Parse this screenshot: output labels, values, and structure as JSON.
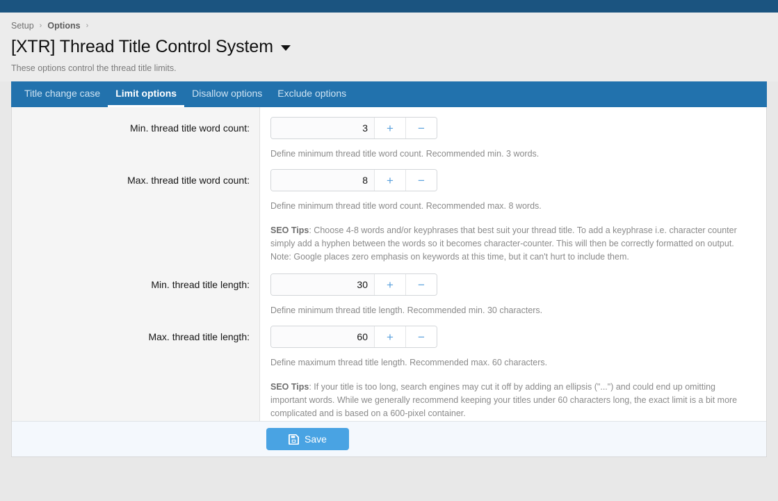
{
  "navbar": {
    "color": "#1b5480"
  },
  "breadcrumb": {
    "items": [
      {
        "label": "Setup"
      },
      {
        "label": "Options"
      }
    ],
    "separator": "›"
  },
  "page": {
    "title": "[XTR] Thread Title Control System",
    "description": "These options control the thread title limits.",
    "caret_icon": "chevron-down-icon"
  },
  "tabs": [
    {
      "label": "Title change case",
      "active": false
    },
    {
      "label": "Limit options",
      "active": true
    },
    {
      "label": "Disallow options",
      "active": false
    },
    {
      "label": "Exclude options",
      "active": false
    }
  ],
  "form": {
    "rows": [
      {
        "label": "Min. thread title word count:",
        "value": "3",
        "plus": "+",
        "minus": "−",
        "help": "Define minimum thread title word count. Recommended min. 3 words."
      },
      {
        "label": "Max. thread title word count:",
        "value": "8",
        "plus": "+",
        "minus": "−",
        "help": "Define minimum thread title word count. Recommended max. 8 words.",
        "tips_label": "SEO Tips",
        "tips_text": ": Choose 4-8 words and/or keyphrases that best suit your thread title. To add a keyphrase i.e. character counter simply add a hyphen between the words so it becomes character-counter. This will then be correctly formatted on output. Note: Google places zero emphasis on keywords at this time, but it can't hurt to include them."
      },
      {
        "label": "Min. thread title length:",
        "value": "30",
        "plus": "+",
        "minus": "−",
        "help": "Define minimum thread title length. Recommended min. 30 characters."
      },
      {
        "label": "Max. thread title length:",
        "value": "60",
        "plus": "+",
        "minus": "−",
        "help": "Define maximum thread title length. Recommended max. 60 characters.",
        "tips_label": "SEO Tips",
        "tips_text": ": If your title is too long, search engines may cut it off by adding an ellipsis (\"...\") and could end up omitting important words. While we generally recommend keeping your titles under 60 characters long, the exact limit is a bit more complicated and is based on a 600-pixel container."
      }
    ]
  },
  "footer": {
    "save_label": "Save",
    "save_icon": "floppy-disk-save-icon",
    "save_color": "#49a3e3"
  },
  "colors": {
    "navbar": "#1b5480",
    "tabbar": "#2272ad",
    "accent": "#49a3e3",
    "stepper_icon": "#5aa1dd",
    "page_bg": "#e8e8e8",
    "label_gutter": "#f5f5f5",
    "footer_bg": "#f4f8fd"
  }
}
